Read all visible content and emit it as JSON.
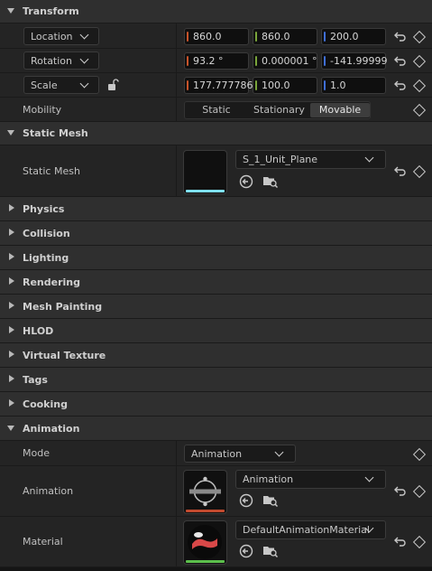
{
  "sections": {
    "transform": "Transform",
    "static_mesh": "Static Mesh",
    "physics": "Physics",
    "collision": "Collision",
    "lighting": "Lighting",
    "rendering": "Rendering",
    "mesh_painting": "Mesh Painting",
    "hlod": "HLOD",
    "virtual_texture": "Virtual Texture",
    "tags": "Tags",
    "cooking": "Cooking",
    "animation": "Animation"
  },
  "transform": {
    "location": {
      "label": "Location",
      "x": "860.0",
      "y": "860.0",
      "z": "200.0"
    },
    "rotation": {
      "label": "Rotation",
      "x": "93.2 °",
      "y": "0.000001 °",
      "z": "-141.99999"
    },
    "scale": {
      "label": "Scale",
      "x": "177.777786",
      "y": "100.0",
      "z": "1.0"
    },
    "mobility": {
      "label": "Mobility",
      "options": [
        "Static",
        "Stationary",
        "Movable"
      ],
      "selected": "Movable"
    }
  },
  "static_mesh": {
    "label": "Static Mesh",
    "asset": "S_1_Unit_Plane"
  },
  "animation": {
    "mode_label": "Mode",
    "mode_value": "Animation",
    "animation_label": "Animation",
    "animation_asset": "Animation",
    "material_label": "Material",
    "material_asset": "DefaultAnimationMaterial"
  },
  "colors": {
    "x_axis": "#c8532a",
    "y_axis": "#7aa53a",
    "z_axis": "#3f6fd6",
    "mesh_underline": "#7fe0f0",
    "anim_underline": "#c34a2f",
    "material_underline": "#5cbf4c"
  },
  "icons": [
    "reset-arrow-icon",
    "keyframe-diamond-icon",
    "unlock-icon",
    "browse-arrow-icon",
    "find-in-browser-icon",
    "chevron-down-icon"
  ]
}
